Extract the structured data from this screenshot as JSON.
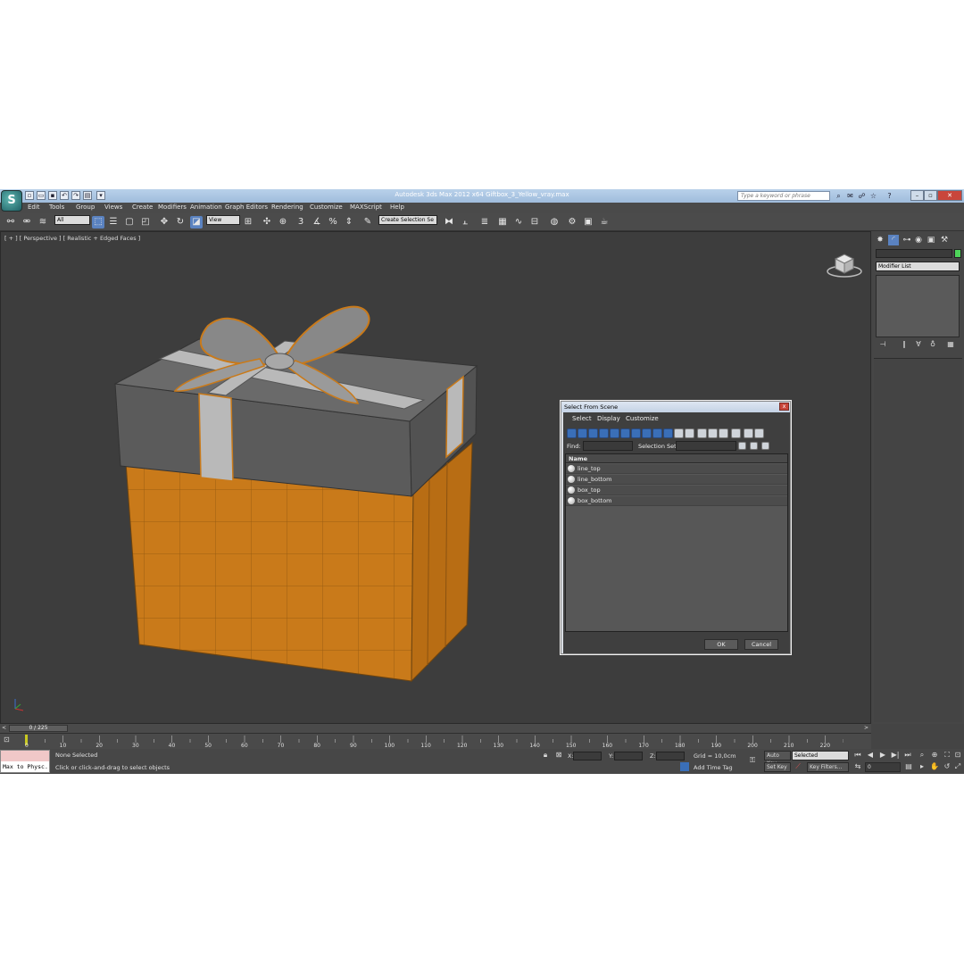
{
  "app": {
    "title": "Autodesk 3ds Max  2012 x64      Giftbox_3_Yellow_vray.max",
    "logo_letter": "S",
    "search_placeholder": "Type a keyword or phrase"
  },
  "menu": [
    "Edit",
    "Tools",
    "Group",
    "Views",
    "Create",
    "Modifiers",
    "Animation",
    "Graph Editors",
    "Rendering",
    "Customize",
    "MAXScript",
    "Help"
  ],
  "toolbar": {
    "filter_value": "All",
    "coord_value": "View",
    "spinner_label": "3",
    "selection_set_value": "Create Selection Se"
  },
  "viewport": {
    "label": "[ + ] [ Perspective ] [ Realistic + Edged Faces ]",
    "colors": {
      "box_orange": "#c97a1a",
      "lid_gray": "#5f5f5f",
      "ribbon": "#b9b9b9"
    }
  },
  "command_panel": {
    "modifier_list": "Modifier List"
  },
  "timeline": {
    "frame": "0 / 225",
    "ticks": [
      "0",
      "10",
      "20",
      "30",
      "40",
      "50",
      "60",
      "70",
      "80",
      "90",
      "100",
      "110",
      "120",
      "130",
      "140",
      "150",
      "160",
      "170",
      "180",
      "190",
      "200",
      "210",
      "220"
    ]
  },
  "status": {
    "maxscript_text": "Max to Physc.",
    "selection": "None Selected",
    "prompt": "Click or click-and-drag to select objects",
    "x_label": "X:",
    "y_label": "Y:",
    "z_label": "Z:",
    "grid": "Grid = 10,0cm",
    "add_time_tag": "Add Time Tag",
    "auto_key": "Auto Key",
    "set_key": "Set Key",
    "key_mode_value": "Selected",
    "key_filters": "Key Filters...",
    "frame_value": "0"
  },
  "dialog": {
    "title": "Select From Scene",
    "close": "x",
    "menu": [
      "Select",
      "Display",
      "Customize"
    ],
    "find_label": "Find:",
    "selection_set_label": "Selection Set:",
    "column_header": "Name",
    "items": [
      "line_top",
      "line_bottom",
      "box_top",
      "box_bottom"
    ],
    "ok": "OK",
    "cancel": "Cancel"
  }
}
